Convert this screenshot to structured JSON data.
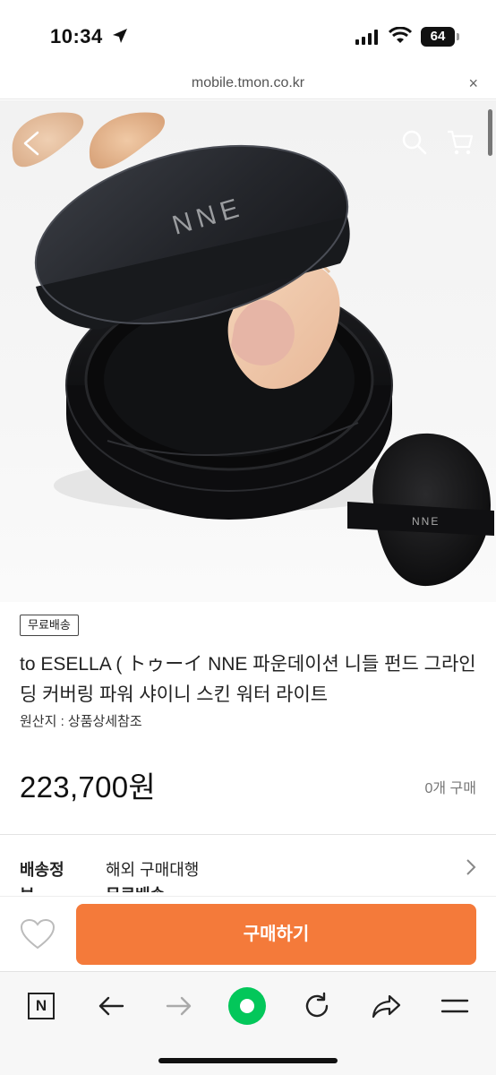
{
  "status": {
    "time": "10:34",
    "battery": "64"
  },
  "browser": {
    "url": "mobile.tmon.co.kr",
    "close_glyph": "×"
  },
  "hero": {
    "icons": [
      "back-arrow-icon",
      "search-icon",
      "cart-icon"
    ],
    "product_lid_text": "NNE",
    "puff_text": "NNE"
  },
  "product": {
    "badge": "무료배송",
    "title": "to ESELLA ( トゥーイ NNE 파운데이션 니들 펀드 그라인딩 커버링 파워 샤이니 스킨 워터 라이트",
    "origin": "원산지 : 상품상세참조",
    "price": "223,700원",
    "sales": "0개 구매"
  },
  "shipping": {
    "label": "배송정",
    "label_cut": "보",
    "value": "해외 구매대행",
    "value_cut": "무료배송"
  },
  "purchase": {
    "buy_label": "구매하기",
    "accent": "#f47a3a"
  },
  "toolbar": {
    "items": [
      "naver-icon",
      "back-icon",
      "forward-icon",
      "green-home-icon",
      "refresh-icon",
      "share-icon",
      "menu-icon"
    ],
    "naver_glyph": "N",
    "green": "#03c75a"
  }
}
